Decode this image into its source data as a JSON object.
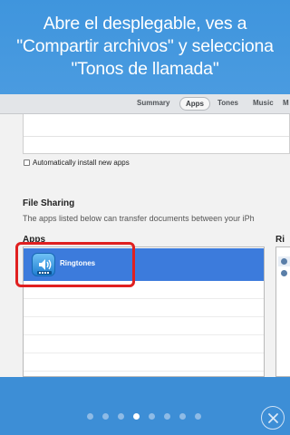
{
  "banner": {
    "line1": "Abre el desplegable, ves a",
    "line2": "\"Compartir archivos\" y selecciona",
    "line3": "\"Tonos de llamada\""
  },
  "tabs": {
    "summary": "Summary",
    "apps": "Apps",
    "tones": "Tones",
    "music": "Music",
    "more": "M"
  },
  "install": {
    "label": "Automatically install new apps",
    "checked": false
  },
  "file_sharing": {
    "title": "File Sharing",
    "description": "The apps listed below can transfer documents between your iPh",
    "apps_header": "Apps",
    "docs_header": "Ri",
    "apps": [
      {
        "name": "Ringtones",
        "selected": true
      }
    ]
  },
  "pager": {
    "count": 8,
    "active_index": 3
  },
  "colors": {
    "banner": "#3f95dd",
    "selection": "#3c7bdc",
    "highlight": "#e02020"
  },
  "icons": {
    "app": "ringtones-speaker-icon",
    "close": "close-icon"
  }
}
